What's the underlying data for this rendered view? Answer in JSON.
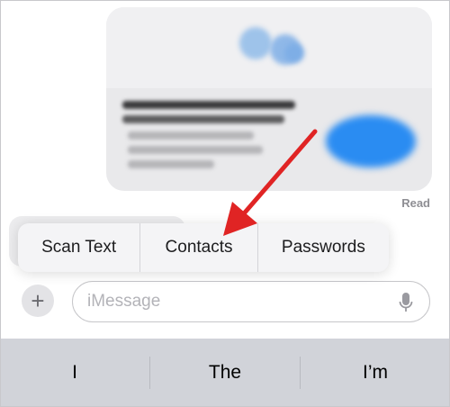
{
  "conversation": {
    "read_receipt": "Read"
  },
  "popup_menu": {
    "items": [
      {
        "label": "Scan Text"
      },
      {
        "label": "Contacts"
      },
      {
        "label": "Passwords"
      }
    ]
  },
  "compose": {
    "plus_icon": "plus-icon",
    "placeholder": "iMessage",
    "value": "",
    "mic_icon": "microphone-icon"
  },
  "keyboard": {
    "suggestions": [
      "I",
      "The",
      "I’m"
    ]
  },
  "annotation": {
    "arrow_color": "#e02424"
  },
  "colors": {
    "accent_blue": "#2a8cf2",
    "keyboard_bg": "#d1d3d9"
  }
}
